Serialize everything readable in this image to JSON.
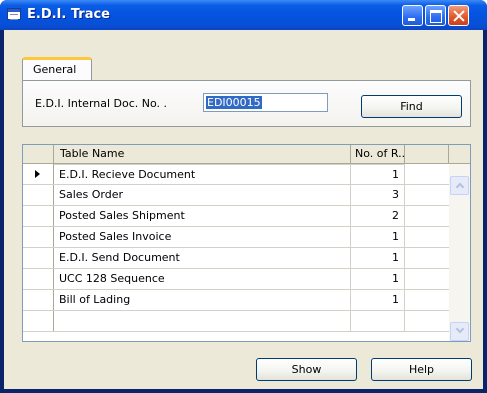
{
  "window": {
    "title": "E.D.I. Trace"
  },
  "tabs": [
    {
      "label": "General"
    }
  ],
  "general": {
    "doc_label": "E.D.I. Internal Doc. No. .",
    "doc_value": "EDI00015",
    "find_button": "Find"
  },
  "table": {
    "columns": [
      "Table Name",
      "No. of R..."
    ],
    "rows": [
      {
        "name": "E.D.I. Recieve Document",
        "count": "1"
      },
      {
        "name": "Sales Order",
        "count": "3"
      },
      {
        "name": "Posted Sales Shipment",
        "count": "2"
      },
      {
        "name": "Posted Sales Invoice",
        "count": "1"
      },
      {
        "name": "E.D.I. Send Document",
        "count": "1"
      },
      {
        "name": "UCC 128 Sequence",
        "count": "1"
      },
      {
        "name": "Bill of Lading",
        "count": "1"
      }
    ]
  },
  "footer": {
    "show_button": "Show",
    "help_button": "Help"
  },
  "icons": {
    "window": "form-window-icon",
    "minimize": "minimize-icon",
    "maximize": "maximize-icon",
    "close": "close-icon",
    "current_row": "row-pointer-icon",
    "scroll_up": "scroll-up-icon",
    "scroll_down": "scroll-down-icon"
  },
  "colors": {
    "titlebar": "#0553e0",
    "client_bg": "#ece9d8",
    "selection": "#316ac5",
    "tab_accent": "#ffc83c",
    "close_button": "#e0552a"
  }
}
